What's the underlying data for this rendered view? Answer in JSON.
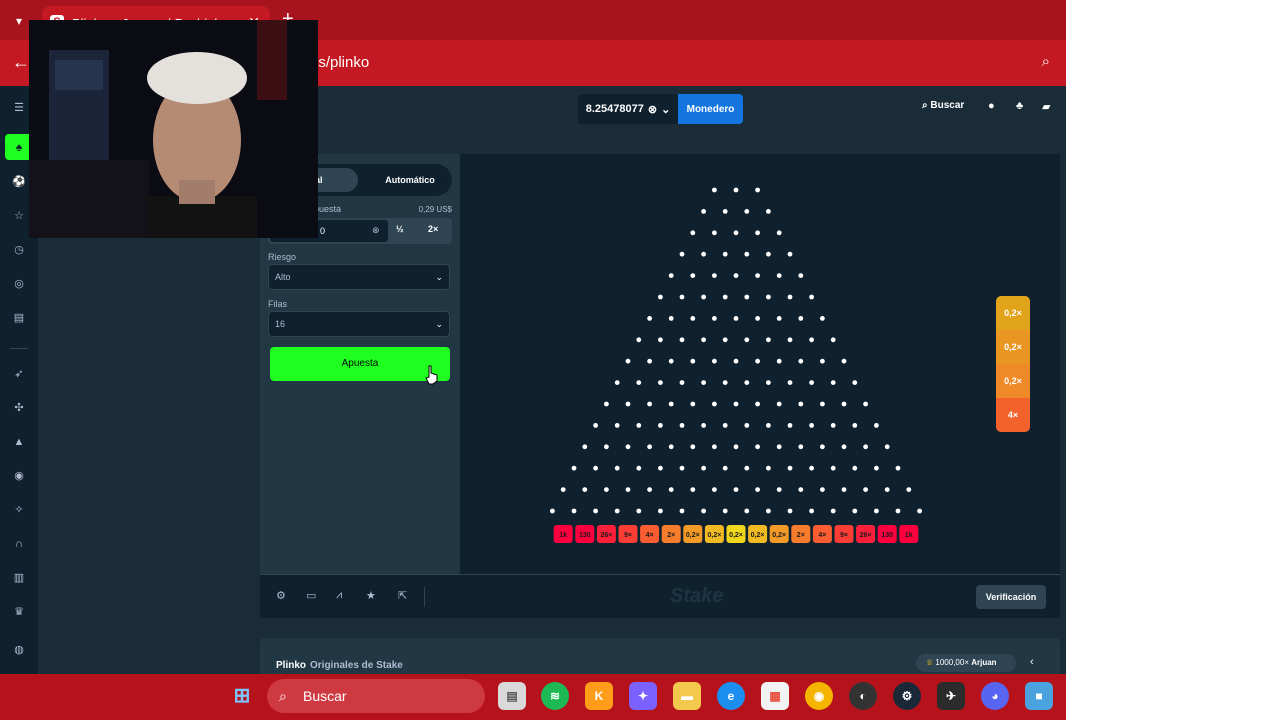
{
  "browser": {
    "tab_title": "Plinko – Juega al Pachinko",
    "tab_favicon": "S",
    "url_fragment": "es/plinko",
    "new_tab": "+",
    "close": "✕"
  },
  "header": {
    "balance": "8.25478077",
    "wallet_label": "Monedero",
    "search_label": "Buscar"
  },
  "controls": {
    "mode_manual": "ual",
    "mode_auto": "Automático",
    "bet_label": "puesta",
    "bet_usd": "0,29 US$",
    "bet_value": "0",
    "half": "½",
    "double": "2×",
    "risk_label": "Riesgo",
    "risk_value": "Alto",
    "rows_label": "Filas",
    "rows_value": "16",
    "bet_button": "Apuesta"
  },
  "plinko": {
    "rows": 16,
    "multipliers": [
      "1k",
      "130",
      "26×",
      "9×",
      "4×",
      "2×",
      "0,2×",
      "0,2×",
      "0,2×",
      "0,2×",
      "0,2×",
      "2×",
      "4×",
      "9×",
      "26×",
      "130",
      "1k"
    ],
    "bucket_colors": [
      "#ff003f",
      "#ff003f",
      "#fe1f3b",
      "#fc3e36",
      "#f95d31",
      "#f77c2c",
      "#f49b27",
      "#f2ba22",
      "#f0d71c",
      "#f2ba22",
      "#f49b27",
      "#f77c2c",
      "#f95d31",
      "#fc3e36",
      "#fe1f3b",
      "#ff003f",
      "#ff003f"
    ],
    "history": [
      {
        "label": "0,2×",
        "color": "#e0a31a"
      },
      {
        "label": "0,2×",
        "color": "#e99722"
      },
      {
        "label": "0,2×",
        "color": "#f08a28"
      },
      {
        "label": "4×",
        "color": "#f4622c"
      }
    ]
  },
  "footer": {
    "watermark": "Stake",
    "verify": "Verificación",
    "game_name": "Plinko",
    "game_sub": "Originales de Stake",
    "badge": "1000,00×",
    "badge_user": "Arjuan"
  },
  "taskbar": {
    "search": "Buscar"
  }
}
